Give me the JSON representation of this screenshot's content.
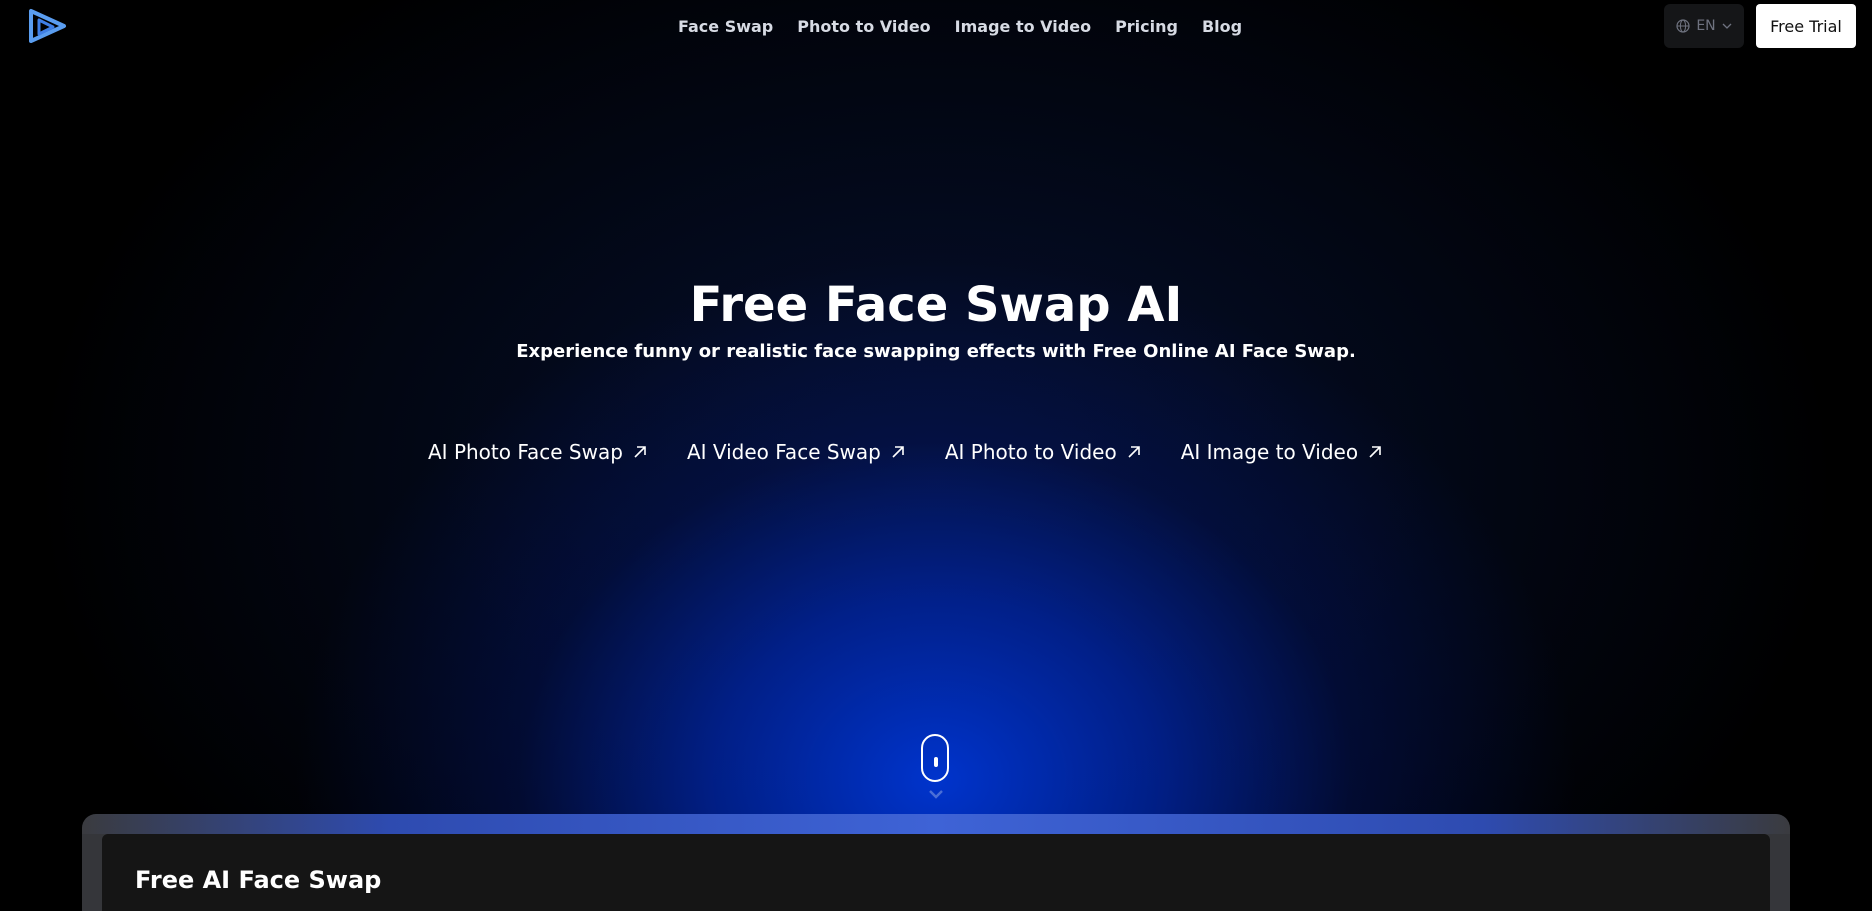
{
  "header": {
    "logo_icon": "play-triangle-logo-icon",
    "nav": [
      {
        "label": "Face Swap"
      },
      {
        "label": "Photo to Video"
      },
      {
        "label": "Image to Video"
      },
      {
        "label": "Pricing"
      },
      {
        "label": "Blog"
      }
    ],
    "language": {
      "icon": "globe-icon",
      "value": "EN",
      "dropdown_icon": "chevron-down-icon"
    },
    "free_trial_label": "Free Trial"
  },
  "hero": {
    "title": "Free Face Swap AI",
    "subtitle": "Experience funny or realistic face swapping effects with Free Online AI Face Swap.",
    "links": [
      {
        "label": "AI Photo Face Swap",
        "icon": "arrow-up-right-icon"
      },
      {
        "label": "AI Video Face Swap",
        "icon": "arrow-up-right-icon"
      },
      {
        "label": "AI Photo to Video",
        "icon": "arrow-up-right-icon"
      },
      {
        "label": "AI Image to Video",
        "icon": "arrow-up-right-icon"
      }
    ],
    "scroll_icon": "mouse-scroll-icon"
  },
  "card": {
    "title": "Free AI Face Swap"
  },
  "colors": {
    "background": "#000000",
    "glow": "#0036d6",
    "text": "#ffffff",
    "nav_text": "#d7dbe4"
  }
}
